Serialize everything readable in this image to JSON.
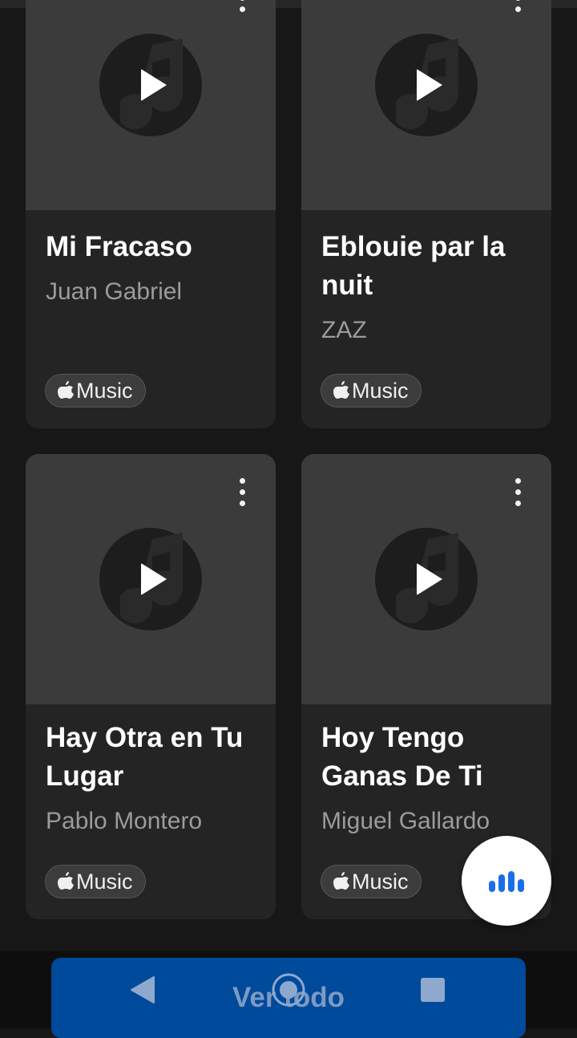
{
  "cards": [
    {
      "title_line1": "Mi Fracaso",
      "title_line2": "",
      "artist": "Juan Gabriel",
      "badge": "Music"
    },
    {
      "title_line1": "Eblouie par la",
      "title_line2": "nuit",
      "artist": "ZAZ",
      "badge": "Music"
    },
    {
      "title_line1": "Hay Otra en Tu",
      "title_line2": "Lugar",
      "artist": "Pablo Montero",
      "badge": "Music"
    },
    {
      "title_line1": "Hoy Tengo",
      "title_line2": "Ganas De Ti",
      "artist": "Miguel Gallardo",
      "badge": "Music"
    }
  ],
  "view_all": "Ver todo",
  "icons": {
    "play": "play-icon",
    "more": "more-vertical-icon",
    "apple": "apple-logo-icon",
    "assistant": "voice-bars-icon",
    "nav_back": "back-triangle-icon",
    "nav_home": "home-circle-icon",
    "nav_recent": "recent-square-icon"
  },
  "colors": {
    "background": "#171717",
    "card": "#242424",
    "artwork": "#3b3b3b",
    "accent_blue": "#1a6fe8",
    "view_all_bg": "#004a9c"
  }
}
